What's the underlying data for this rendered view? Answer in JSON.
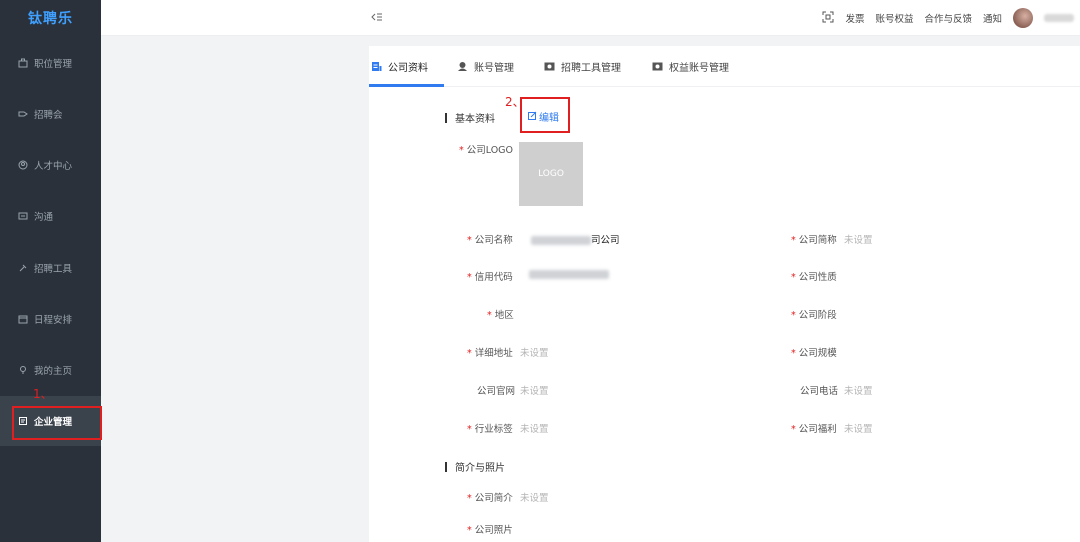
{
  "app": {
    "logo": "钛聘乐"
  },
  "sidebar": {
    "items": [
      {
        "label": "职位管理",
        "icon": "briefcase-icon"
      },
      {
        "label": "招聘会",
        "icon": "tag-icon"
      },
      {
        "label": "人才中心",
        "icon": "user-circle-icon"
      },
      {
        "label": "沟通",
        "icon": "chat-icon"
      },
      {
        "label": "招聘工具",
        "icon": "tools-icon"
      },
      {
        "label": "日程安排",
        "icon": "calendar-icon"
      },
      {
        "label": "我的主页",
        "icon": "pin-icon"
      },
      {
        "label": "企业管理",
        "icon": "building-icon",
        "active": true
      }
    ]
  },
  "topbar": {
    "invoice": "发票",
    "account_rights": "账号权益",
    "feedback": "合作与反馈",
    "notice": "通知"
  },
  "tabs": [
    {
      "label": "公司资料",
      "active": true
    },
    {
      "label": "账号管理"
    },
    {
      "label": "招聘工具管理"
    },
    {
      "label": "权益账号管理"
    }
  ],
  "basic": {
    "title": "基本资料",
    "edit": "编辑",
    "logo_label": "公司LOGO",
    "logo_placeholder": "LOGO",
    "company_name_label": "公司名称",
    "company_name_suffix": "司公司",
    "short_name_label": "公司简称",
    "credit_code_label": "信用代码",
    "nature_label": "公司性质",
    "region_label": "地区",
    "stage_label": "公司阶段",
    "address_label": "详细地址",
    "scale_label": "公司规模",
    "website_label": "公司官网",
    "phone_label": "公司电话",
    "industry_label": "行业标签",
    "welfare_label": "公司福利",
    "unset": "未设置"
  },
  "intro": {
    "title": "简介与照片",
    "intro_label": "公司简介",
    "photos_label": "公司照片"
  },
  "annotations": {
    "step1": "1、",
    "step2": "2、"
  },
  "colors": {
    "accent": "#2f7bef",
    "sidebar_bg": "#2a313b",
    "highlight": "#e02020"
  }
}
